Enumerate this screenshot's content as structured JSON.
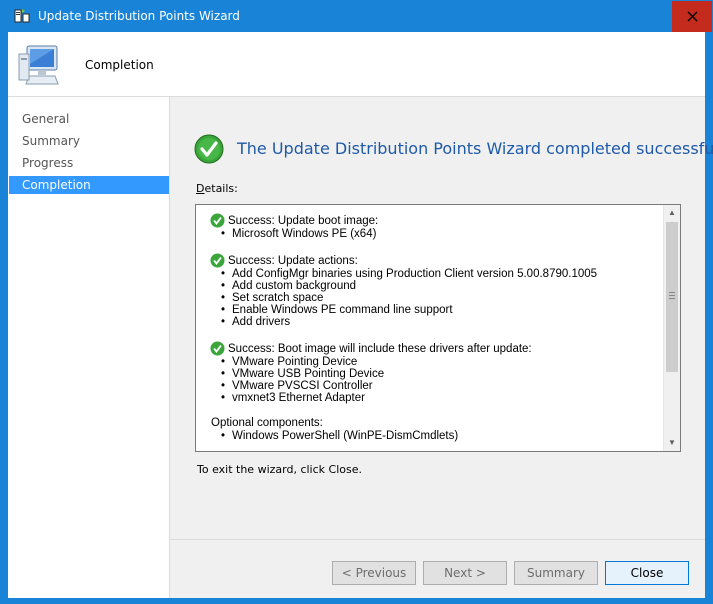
{
  "window": {
    "title": "Update Distribution Points Wizard"
  },
  "banner": {
    "title": "Completion"
  },
  "nav": {
    "items": [
      {
        "label": "General"
      },
      {
        "label": "Summary"
      },
      {
        "label": "Progress"
      },
      {
        "label": "Completion",
        "active": true
      }
    ]
  },
  "main": {
    "headline": "The Update Distribution Points Wizard completed successfully",
    "details_label_first": "D",
    "details_label_rest": "etails:",
    "exit_text": "To exit the wizard, click Close."
  },
  "details": {
    "sections": [
      {
        "title": "Success: Update boot image:",
        "items": [
          "Microsoft Windows PE (x64)"
        ]
      },
      {
        "title": "Success: Update actions:",
        "items": [
          "Add ConfigMgr binaries using Production Client version 5.00.8790.1005",
          "Add custom background",
          "Set scratch space",
          "Enable Windows PE command line support",
          "Add drivers"
        ]
      },
      {
        "title": "Success: Boot image will include these drivers after update:",
        "items": [
          "VMware Pointing Device",
          "VMware USB Pointing Device",
          "VMware PVSCSI Controller",
          "vmxnet3 Ethernet Adapter"
        ]
      }
    ],
    "optional_title": "Optional components:",
    "optional_items": [
      "Windows PowerShell (WinPE-DismCmdlets)"
    ]
  },
  "buttons": {
    "previous": "< Previous",
    "next": "Next >",
    "summary": "Summary",
    "close": "Close"
  },
  "colors": {
    "accent": "#1883d7",
    "headline": "#1e5aa8",
    "selection": "#3399ff",
    "close_hover": "#c42b1c"
  }
}
